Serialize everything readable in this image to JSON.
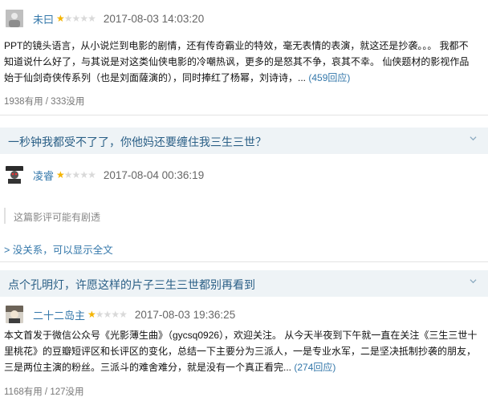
{
  "reviews": [
    {
      "username": "未曰",
      "rating": 1,
      "max_rating": 5,
      "date": "2017-08-03 14:03:20",
      "text": "PPT的镜头语言，从小说烂到电影的剧情，还有传奇霸业的特效，毫无表情的表演，就这还是抄袭。。。 我都不知道说什么好了，与其说是对这类仙侠电影的冷嘲热讽，更多的是怒其不争，哀其不幸。 仙侠题材的影视作品始于仙剑奇侠传系列（也是刘面薩演的），同时捧红了杨幂，刘诗诗，...",
      "reply_link": "(459回应)",
      "votes": "1938有用 / 333没用"
    },
    {
      "username": "凌睿",
      "rating": 1,
      "max_rating": 5,
      "date": "2017-08-04 00:36:19",
      "spoiler_notice": "这篇影评可能有剧透",
      "show_full_link": "> 没关系，可以显示全文"
    },
    {
      "username": "二十二岛主",
      "rating": 1,
      "max_rating": 5,
      "date": "2017-08-03 19:36:25",
      "text": "本文首发于微信公众号《光影薄生曲》（gycsq0926），欢迎关注。 从今天半夜到下午就一直在关注《三生三世十里桃花》的豆瓣短评区和长评区的变化，总结一下主要分为三派人，一是专业水军，二是坚决抵制抄袭的朋友，三是两位主演的粉丝。三派斗的难舍难分，就是没有一个真正看完...",
      "reply_link": "(274回应)",
      "votes": "1168有用 / 127没用"
    }
  ],
  "banners": [
    {
      "title": "一秒钟我都受不了了，你他妈还要缠住我三生三世？"
    },
    {
      "title": "点个孔明灯，许愿这样的片子三生三世都别再看到"
    }
  ],
  "icons": {
    "star": "star-icon",
    "chevron": "chevron-down-icon"
  },
  "colors": {
    "link": "#3377aa",
    "star_on": "#f4b400",
    "star_off": "#d9d9d9",
    "banner_bg": "#eef3f6",
    "banner_text": "#2a5f86"
  }
}
